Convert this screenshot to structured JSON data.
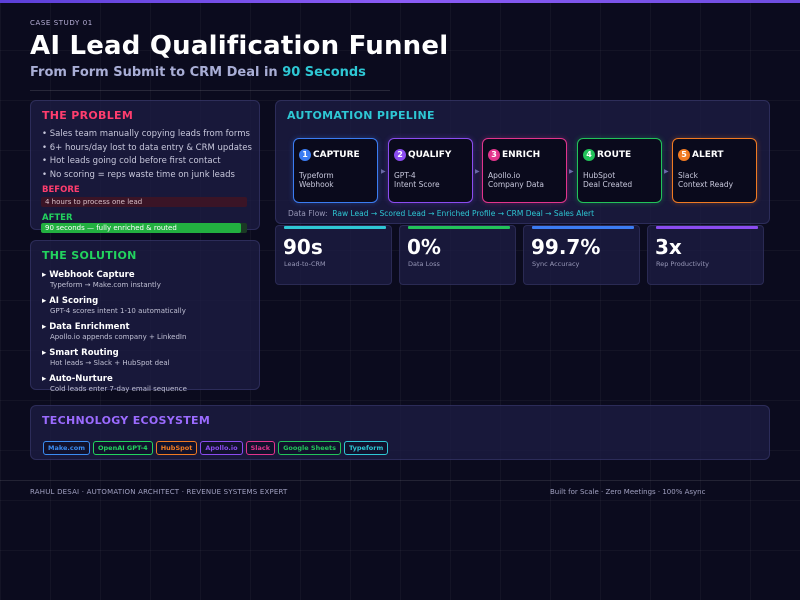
{
  "header": {
    "eyebrow": "CASE STUDY 01",
    "title": "AI Lead Qualification Funnel",
    "subtitle_prefix": "From Form Submit to CRM Deal in ",
    "subtitle_highlight": "90 Seconds"
  },
  "problem": {
    "title": "THE PROBLEM",
    "bullets": [
      "• Sales team manually copying leads from forms",
      "• 6+ hours/day lost to data entry & CRM updates",
      "• Hot leads going cold before first contact",
      "• No scoring = reps waste time on junk leads"
    ],
    "before_label": "BEFORE",
    "before_text": "4 hours to process one lead",
    "after_label": "AFTER",
    "after_text": "90 seconds — fully enriched & routed",
    "after_fill": 0.97
  },
  "solution": {
    "title": "THE SOLUTION",
    "items": [
      {
        "heading": "▸ Webhook Capture",
        "desc": "Typeform → Make.com instantly"
      },
      {
        "heading": "▸ AI Scoring",
        "desc": "GPT-4 scores intent 1-10 automatically"
      },
      {
        "heading": "▸ Data Enrichment",
        "desc": "Apollo.io appends company + LinkedIn"
      },
      {
        "heading": "▸ Smart Routing",
        "desc": "Hot leads → Slack + HubSpot deal"
      },
      {
        "heading": "▸ Auto-Nurture",
        "desc": "Cold leads enter 7-day email sequence"
      }
    ]
  },
  "pipeline": {
    "title": "AUTOMATION PIPELINE",
    "steps": [
      {
        "num": "1",
        "name": "CAPTURE",
        "line1": "Typeform",
        "line2": "Webhook",
        "color": "#3b7cf2"
      },
      {
        "num": "2",
        "name": "QUALIFY",
        "line1": "GPT-4",
        "line2": "Intent Score",
        "color": "#8b4cf0"
      },
      {
        "num": "3",
        "name": "ENRICH",
        "line1": "Apollo.io",
        "line2": "Company Data",
        "color": "#e2348c"
      },
      {
        "num": "4",
        "name": "ROUTE",
        "line1": "HubSpot",
        "line2": "Deal Created",
        "color": "#22c35a"
      },
      {
        "num": "5",
        "name": "ALERT",
        "line1": "Slack",
        "line2": "Context Ready",
        "color": "#f07a22"
      }
    ],
    "arrow_glyph": "▶",
    "flow_label": "Data Flow:",
    "flow_value": "Raw Lead → Scored Lead → Enriched Profile → CRM Deal → Sales Alert"
  },
  "metrics": [
    {
      "value": "90s",
      "label": "Lead-to-CRM",
      "color": "#2ec7d4"
    },
    {
      "value": "0%",
      "label": "Data Loss",
      "color": "#22c35a"
    },
    {
      "value": "99.7%",
      "label": "Sync Accuracy",
      "color": "#3b7cf2"
    },
    {
      "value": "3x",
      "label": "Rep Productivity",
      "color": "#8b4cf0"
    }
  ],
  "tech": {
    "title": "TECHNOLOGY ECOSYSTEM",
    "chips": [
      {
        "label": "Make.com",
        "color": "#3b8cf2"
      },
      {
        "label": "OpenAI GPT-4",
        "color": "#22d35e"
      },
      {
        "label": "HubSpot",
        "color": "#f07a22"
      },
      {
        "label": "Apollo.io",
        "color": "#8b4cf0"
      },
      {
        "label": "Slack",
        "color": "#e2348c"
      },
      {
        "label": "Google Sheets",
        "color": "#22c35a"
      },
      {
        "label": "Typeform",
        "color": "#2ec7d4"
      }
    ]
  },
  "footer": {
    "left": "RAHUL DESAI  ·  AUTOMATION ARCHITECT  ·  REVENUE SYSTEMS EXPERT",
    "right": "Built for Scale · Zero Meetings · 100% Async"
  }
}
